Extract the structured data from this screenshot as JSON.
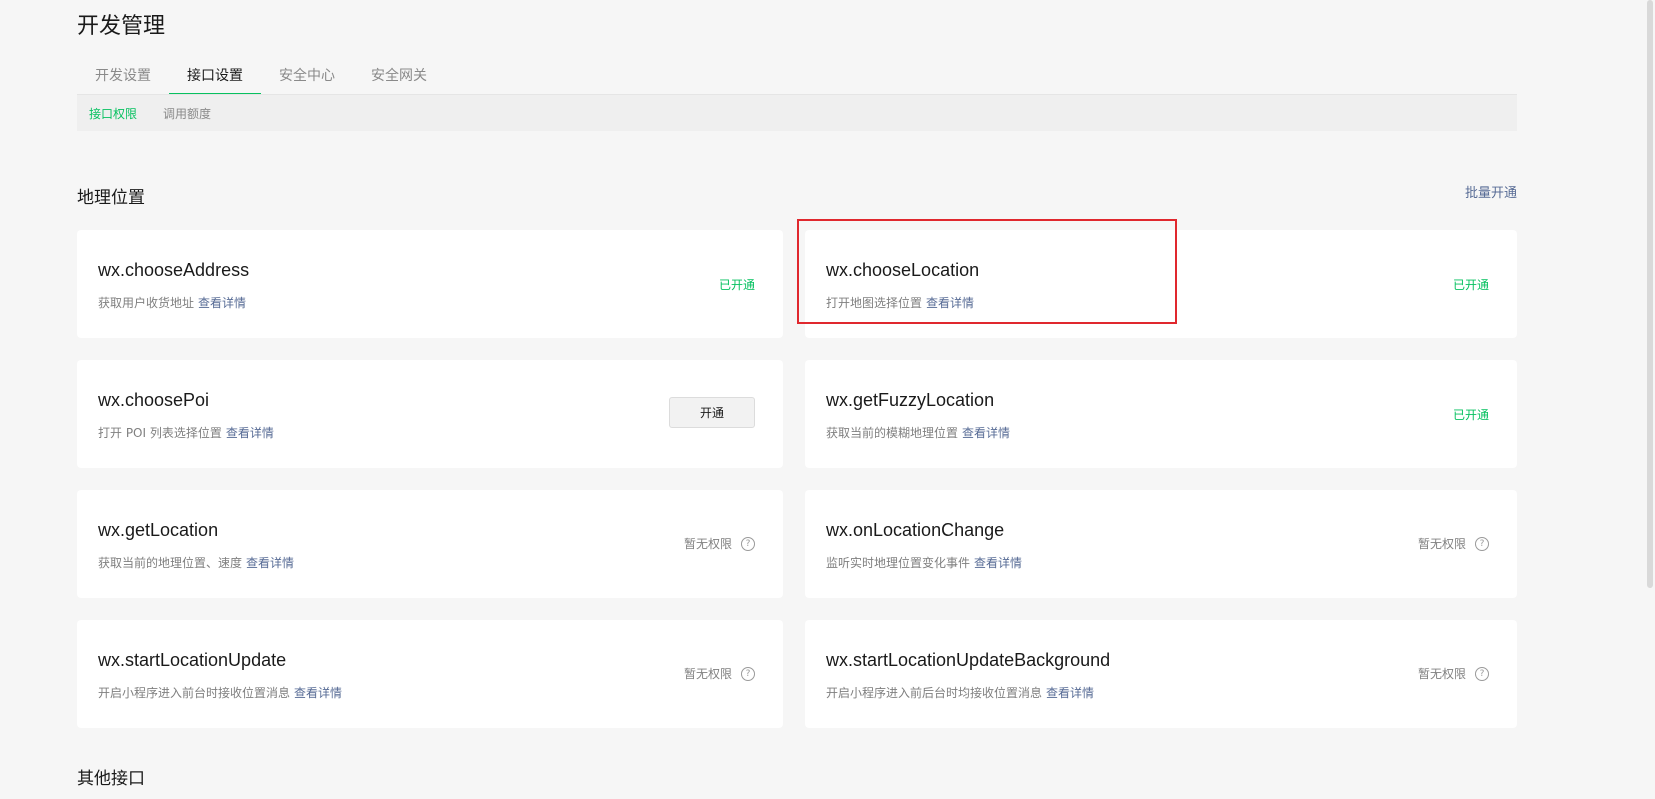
{
  "page_title": "开发管理",
  "tabs": [
    {
      "label": "开发设置",
      "active": false
    },
    {
      "label": "接口设置",
      "active": true
    },
    {
      "label": "安全中心",
      "active": false
    },
    {
      "label": "安全网关",
      "active": false
    }
  ],
  "subtabs": [
    {
      "label": "接口权限",
      "active": true
    },
    {
      "label": "调用额度",
      "active": false
    }
  ],
  "section_location": {
    "title": "地理位置",
    "batch_label": "批量开通"
  },
  "section_other": {
    "title": "其他接口"
  },
  "detail_label": "查看详情",
  "cards": [
    {
      "name": "wx.chooseAddress",
      "desc": "获取用户收货地址",
      "status_type": "enabled",
      "status": "已开通"
    },
    {
      "name": "wx.chooseLocation",
      "desc": "打开地图选择位置",
      "status_type": "enabled",
      "status": "已开通"
    },
    {
      "name": "wx.choosePoi",
      "desc": "打开 POI 列表选择位置",
      "status_type": "button",
      "status": "开通"
    },
    {
      "name": "wx.getFuzzyLocation",
      "desc": "获取当前的模糊地理位置",
      "status_type": "enabled",
      "status": "已开通"
    },
    {
      "name": "wx.getLocation",
      "desc": "获取当前的地理位置、速度",
      "status_type": "none",
      "status": "暂无权限"
    },
    {
      "name": "wx.onLocationChange",
      "desc": "监听实时地理位置变化事件",
      "status_type": "none",
      "status": "暂无权限"
    },
    {
      "name": "wx.startLocationUpdate",
      "desc": "开启小程序进入前台时接收位置消息",
      "status_type": "none",
      "status": "暂无权限"
    },
    {
      "name": "wx.startLocationUpdateBackground",
      "desc": "开启小程序进入前后台时均接收位置消息",
      "status_type": "none",
      "status": "暂无权限"
    }
  ],
  "colors": {
    "accent_green": "#07c160",
    "link_blue": "#576b95",
    "highlight_red": "#e0282e"
  }
}
